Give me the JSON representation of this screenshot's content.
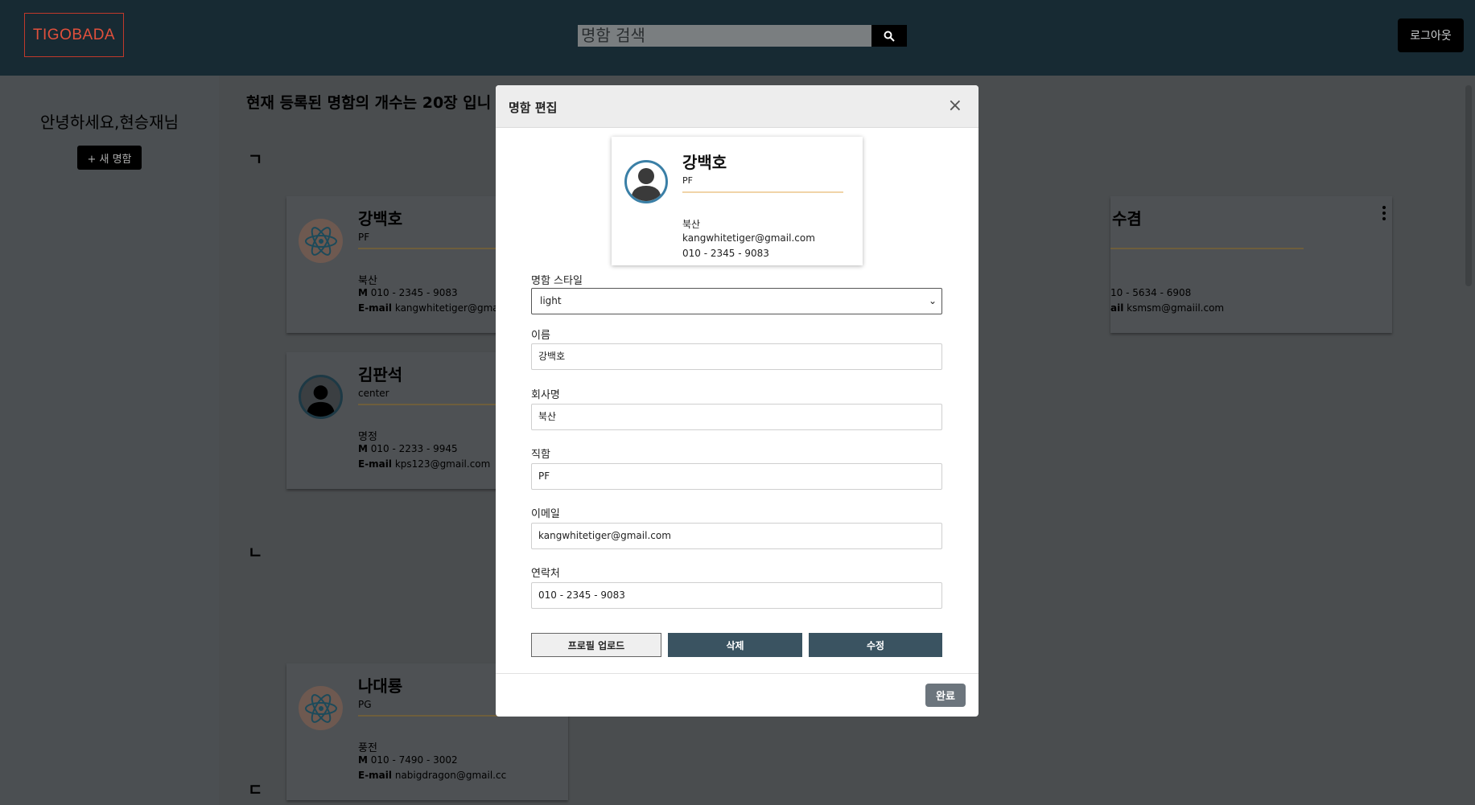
{
  "header": {
    "logo_text": "TIGOBADA",
    "search_placeholder": "명함 검색",
    "logout_label": "로그아웃"
  },
  "sidebar": {
    "greeting": "안녕하세요,현승재님",
    "new_card_label": "+ 새 명함"
  },
  "main": {
    "count_text": "현재 등록된 명함의 개수는 20장 입니",
    "sections": [
      "ㄱ",
      "ㄴ",
      "ㄷ"
    ],
    "cards": [
      {
        "name": "강백호",
        "role": "PF",
        "company": "북산",
        "phone_label": "M",
        "phone": "010 - 2345 - 9083",
        "email_label": "E-mail",
        "email": "kangwhitetiger@gmail.",
        "avatar": "atom-icon"
      },
      {
        "name": "김판석",
        "role": "center",
        "company": "명정",
        "phone_label": "M",
        "phone": "010 - 2233 - 9945",
        "email_label": "E-mail",
        "email": "kps123@gmail.com",
        "avatar": "person-icon"
      },
      {
        "name": "나대룡",
        "role": "PG",
        "company": "풍전",
        "phone_label": "M",
        "phone": "010 - 7490 - 3002",
        "email_label": "E-mail",
        "email": "nabigdragon@gmail.cc",
        "avatar": "atom-icon"
      },
      {
        "name": "수겸",
        "role": "",
        "company": "",
        "phone_label": "",
        "phone": "10 - 5634 - 6908",
        "email_label": "ail",
        "email": "ksmsm@gmaiil.com",
        "avatar": ""
      }
    ]
  },
  "modal": {
    "title": "명함 편집",
    "close": "×",
    "preview": {
      "name": "강백호",
      "role": "PF",
      "company": "북산",
      "email": "kangwhitetiger@gmail.com",
      "phone": "010 - 2345 - 9083"
    },
    "fields": {
      "style_label": "명함 스타일",
      "style_value": "light",
      "name_label": "이름",
      "name_value": "강백호",
      "company_label": "회사명",
      "company_value": "북산",
      "title_label": "직함",
      "title_value": "PF",
      "email_label": "이메일",
      "email_value": "kangwhitetiger@gmail.com",
      "phone_label": "연락처",
      "phone_value": "010 - 2345 - 9083"
    },
    "buttons": {
      "upload": "프로필 업로드",
      "delete": "삭제",
      "edit": "수정",
      "done": "완료"
    }
  },
  "colors": {
    "header_bg": "#172a33",
    "overlay_bg": "#4b4f52",
    "button_dark": "#3a5361",
    "done_button": "#6c757d",
    "logo_accent": "#e53a2a"
  }
}
